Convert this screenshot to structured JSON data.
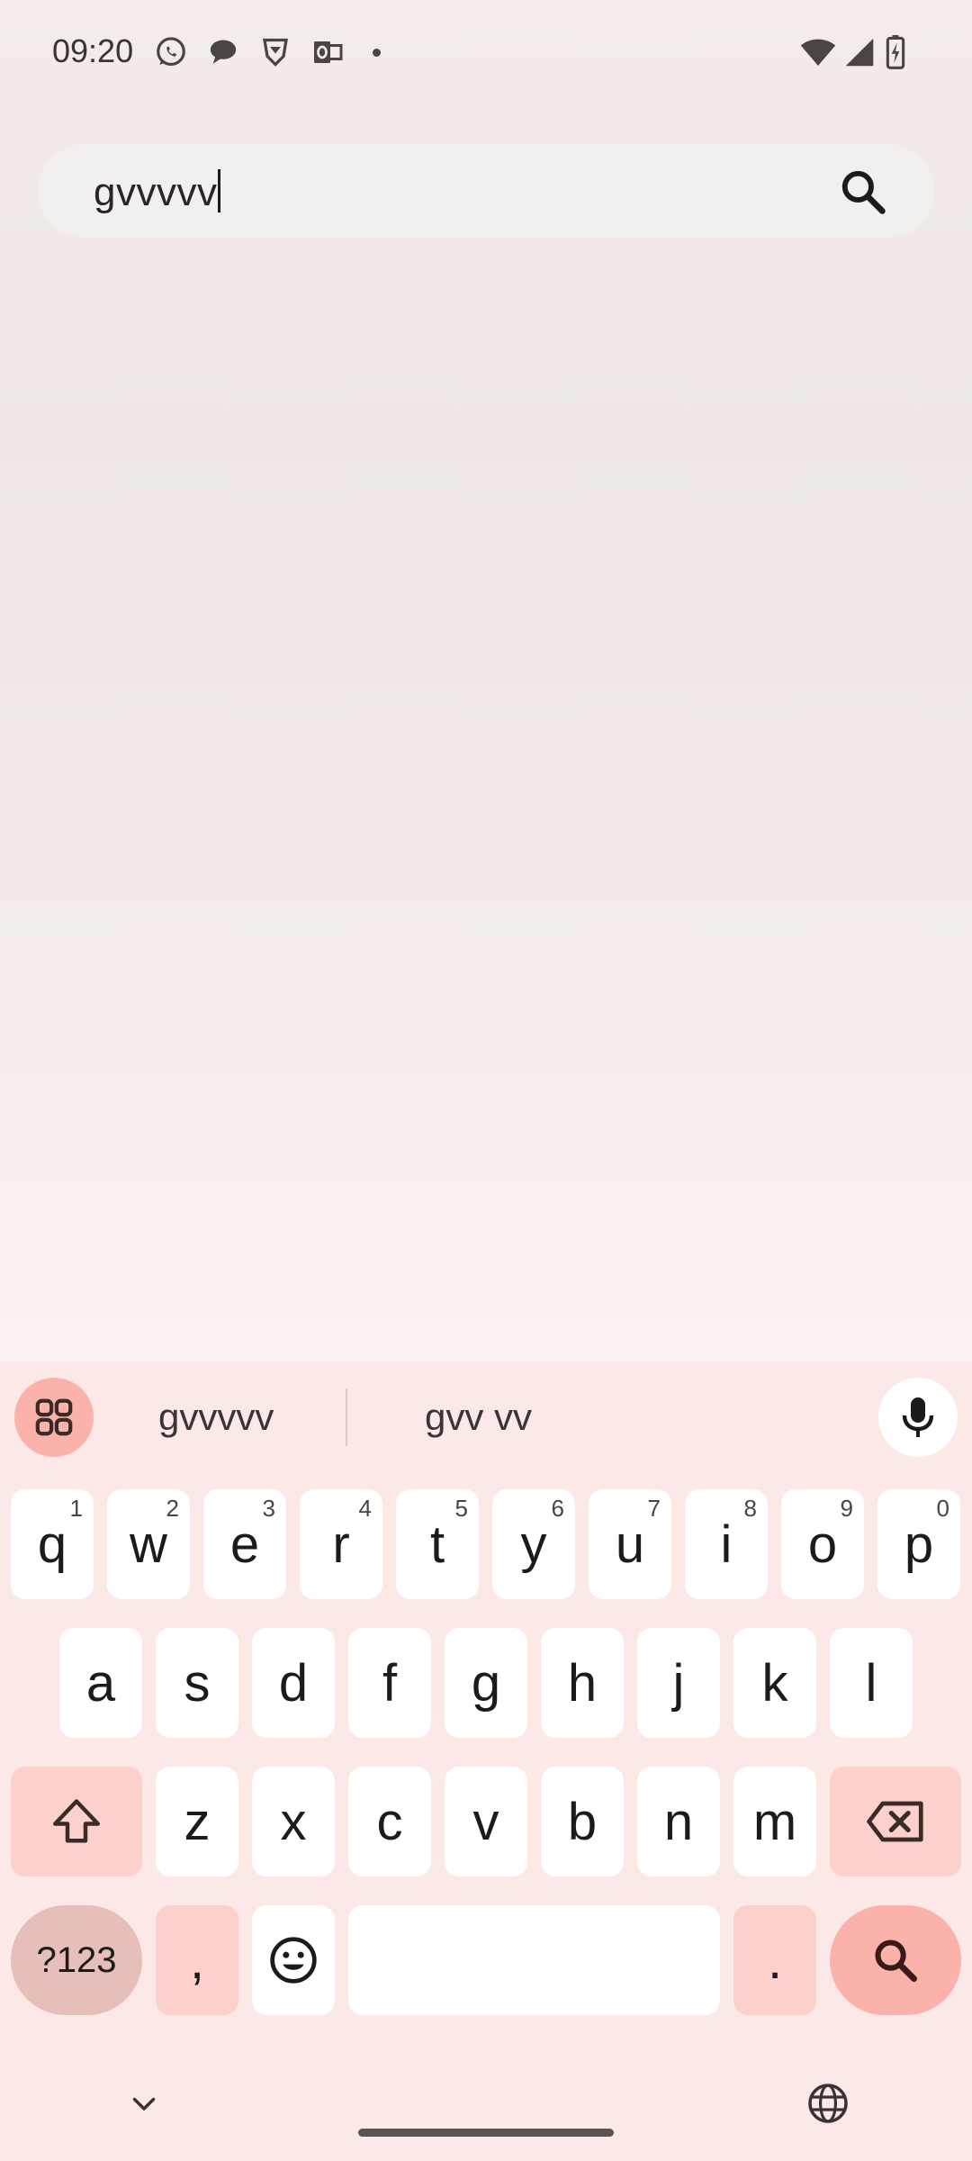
{
  "status_bar": {
    "time": "09:20",
    "notification_icons": [
      "whatsapp-icon",
      "chat-bubble-icon",
      "brave-icon",
      "outlook-icon"
    ],
    "system_icons": [
      "wifi-icon",
      "signal-icon",
      "battery-charging-icon"
    ]
  },
  "search": {
    "query": "gvvvvv",
    "icon": "search-icon"
  },
  "keyboard": {
    "suggestions": [
      "gvvvvv",
      "gvv vv"
    ],
    "row1": [
      {
        "label": "q",
        "hint": "1"
      },
      {
        "label": "w",
        "hint": "2"
      },
      {
        "label": "e",
        "hint": "3"
      },
      {
        "label": "r",
        "hint": "4"
      },
      {
        "label": "t",
        "hint": "5"
      },
      {
        "label": "y",
        "hint": "6"
      },
      {
        "label": "u",
        "hint": "7"
      },
      {
        "label": "i",
        "hint": "8"
      },
      {
        "label": "o",
        "hint": "9"
      },
      {
        "label": "p",
        "hint": "0"
      }
    ],
    "row2": [
      "a",
      "s",
      "d",
      "f",
      "g",
      "h",
      "j",
      "k",
      "l"
    ],
    "row3": [
      "z",
      "x",
      "c",
      "v",
      "b",
      "n",
      "m"
    ],
    "symbols_label": "?123",
    "comma_label": ",",
    "period_label": ".",
    "colors": {
      "keyboard_bg": "#fce8e6",
      "key": "#ffffff",
      "function_key": "#fcd1cc",
      "accent": "#fbb2aa"
    }
  }
}
